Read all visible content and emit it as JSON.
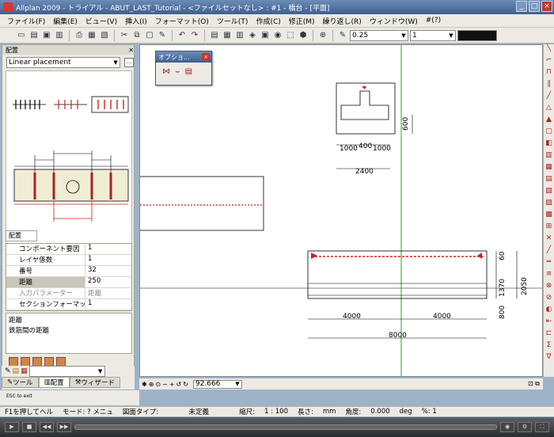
{
  "window": {
    "title": "Allplan 2009 - トライアル - ABUT_LAST_Tutorial - <ファイルセットなし> : #1 - 橋台 - [平面]"
  },
  "menu": [
    "ファイル(F)",
    "編集(E)",
    "ビュー(V)",
    "挿入(I)",
    "フォーマット(O)",
    "ツール(T)",
    "作成(C)",
    "修正(M)",
    "繰り返し(R)",
    "ウィンドウ(W)",
    "#(?)"
  ],
  "toolbar": {
    "pen_value": "0.25",
    "line_value": "1"
  },
  "left_panel": {
    "title": "配置",
    "placement_select": "Linear placement",
    "props_tab": "配置",
    "properties": [
      {
        "key": "コンポーネント要因",
        "value": "1"
      },
      {
        "key": "レイヤ係数",
        "value": "1"
      },
      {
        "key": "番号",
        "value": "32"
      },
      {
        "key": "距離",
        "value": "250"
      },
      {
        "key": "入力パラメーター",
        "value": "距離"
      },
      {
        "key": "セクションフォーマット",
        "value": "1"
      }
    ],
    "desc_title": "距離",
    "desc_text": "鉄筋間の距離",
    "tabs": [
      "ツール",
      "配置",
      "ウィザード"
    ]
  },
  "palette": {
    "title": "オプショ..."
  },
  "canvas": {
    "dims": [
      "1000",
      "400",
      "1000",
      "2400",
      "600",
      "4000",
      "4000",
      "8000",
      "1370",
      "2050",
      "800",
      "60"
    ]
  },
  "nav": {
    "zoom": "92.666"
  },
  "esc_hint": "ESC to exit",
  "status": {
    "help": "F1を押してヘル",
    "mode": "モード: ? メニュ",
    "type_label": "図面タイプ:",
    "type_value": "未定義",
    "scale_label": "縮尺:",
    "scale_value": "1 : 100",
    "length_label": "長さ:",
    "length_unit": "mm",
    "angle_label": "角度:",
    "angle_value": "0.000",
    "angle_unit": "deg",
    "percent": "%: 1"
  }
}
